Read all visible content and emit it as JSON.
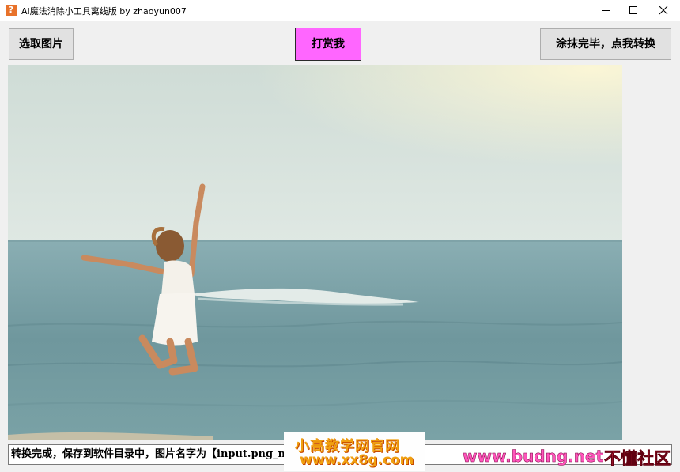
{
  "window": {
    "title": "AI魔法消除小工具离线版   by zhaoyun007",
    "icon_glyph": "?"
  },
  "toolbar": {
    "select_label": "选取图片",
    "tip_label": "打赏我",
    "convert_label": "涂抹完毕，点我转换"
  },
  "status": {
    "text": "转换完成，保存到软件目录中，图片名字为【input.png_m"
  },
  "watermarks": {
    "site1_line1": "小高教学网官网",
    "site1_line2": "www.xx8g.com",
    "site2_url": "www.budng.net",
    "site2_name": "不懂社区"
  },
  "colors": {
    "tip_button": "#ff66ff",
    "window_bg": "#f0f0f0"
  }
}
